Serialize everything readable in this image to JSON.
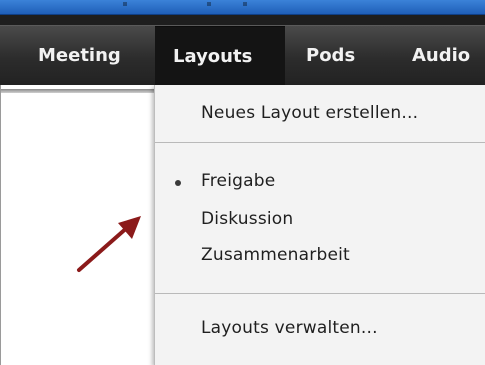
{
  "menubar": {
    "items": [
      {
        "label": "Meeting"
      },
      {
        "label": "Layouts"
      },
      {
        "label": "Pods"
      },
      {
        "label": "Audio"
      }
    ],
    "active_item": "Layouts"
  },
  "dropdown": {
    "items": [
      {
        "label": "Neues Layout erstellen..."
      },
      {
        "label": "Freigabe",
        "selected": true
      },
      {
        "label": "Diskussion"
      },
      {
        "label": "Zusammenarbeit"
      },
      {
        "label": "Layouts verwalten..."
      }
    ]
  },
  "annotation": {
    "arrow_color": "#8b1a1a",
    "arrow_icon": "pointer-arrow-icon"
  },
  "colors": {
    "menubar_bg": "#2c2c2c",
    "menu_text": "#f2f2f2",
    "dropdown_bg": "#f3f3f3",
    "top_strip_blue": "#2b6fd0"
  }
}
